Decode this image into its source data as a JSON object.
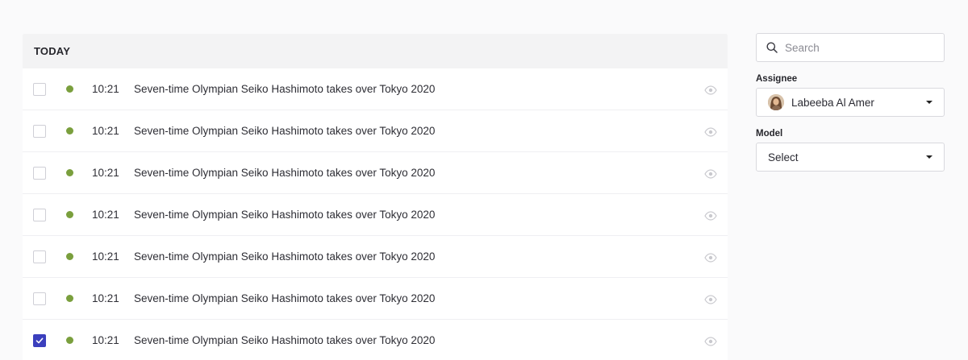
{
  "list": {
    "header": "TODAY",
    "rows": [
      {
        "time": "10:21",
        "title": "Seven-time Olympian Seiko Hashimoto takes over Tokyo 2020",
        "checked": false
      },
      {
        "time": "10:21",
        "title": "Seven-time Olympian Seiko Hashimoto takes over Tokyo 2020",
        "checked": false
      },
      {
        "time": "10:21",
        "title": "Seven-time Olympian Seiko Hashimoto takes over Tokyo 2020",
        "checked": false
      },
      {
        "time": "10:21",
        "title": "Seven-time Olympian Seiko Hashimoto takes over Tokyo 2020",
        "checked": false
      },
      {
        "time": "10:21",
        "title": "Seven-time Olympian Seiko Hashimoto takes over Tokyo 2020",
        "checked": false
      },
      {
        "time": "10:21",
        "title": "Seven-time Olympian Seiko Hashimoto takes over Tokyo 2020",
        "checked": false
      },
      {
        "time": "10:21",
        "title": "Seven-time Olympian Seiko Hashimoto takes over Tokyo 2020",
        "checked": true
      }
    ]
  },
  "filters": {
    "search": {
      "placeholder": "Search",
      "value": ""
    },
    "assignee": {
      "label": "Assignee",
      "value": "Labeeba Al Amer"
    },
    "model": {
      "label": "Model",
      "value": "Select"
    }
  },
  "colors": {
    "status_dot": "#7a9f3d",
    "checkbox_checked": "#3b3fbd",
    "header_bg": "#f3f3f4"
  },
  "icons": {
    "search": "search-icon",
    "eye": "eye-icon",
    "caret": "caret-down-icon",
    "check": "check-icon"
  }
}
